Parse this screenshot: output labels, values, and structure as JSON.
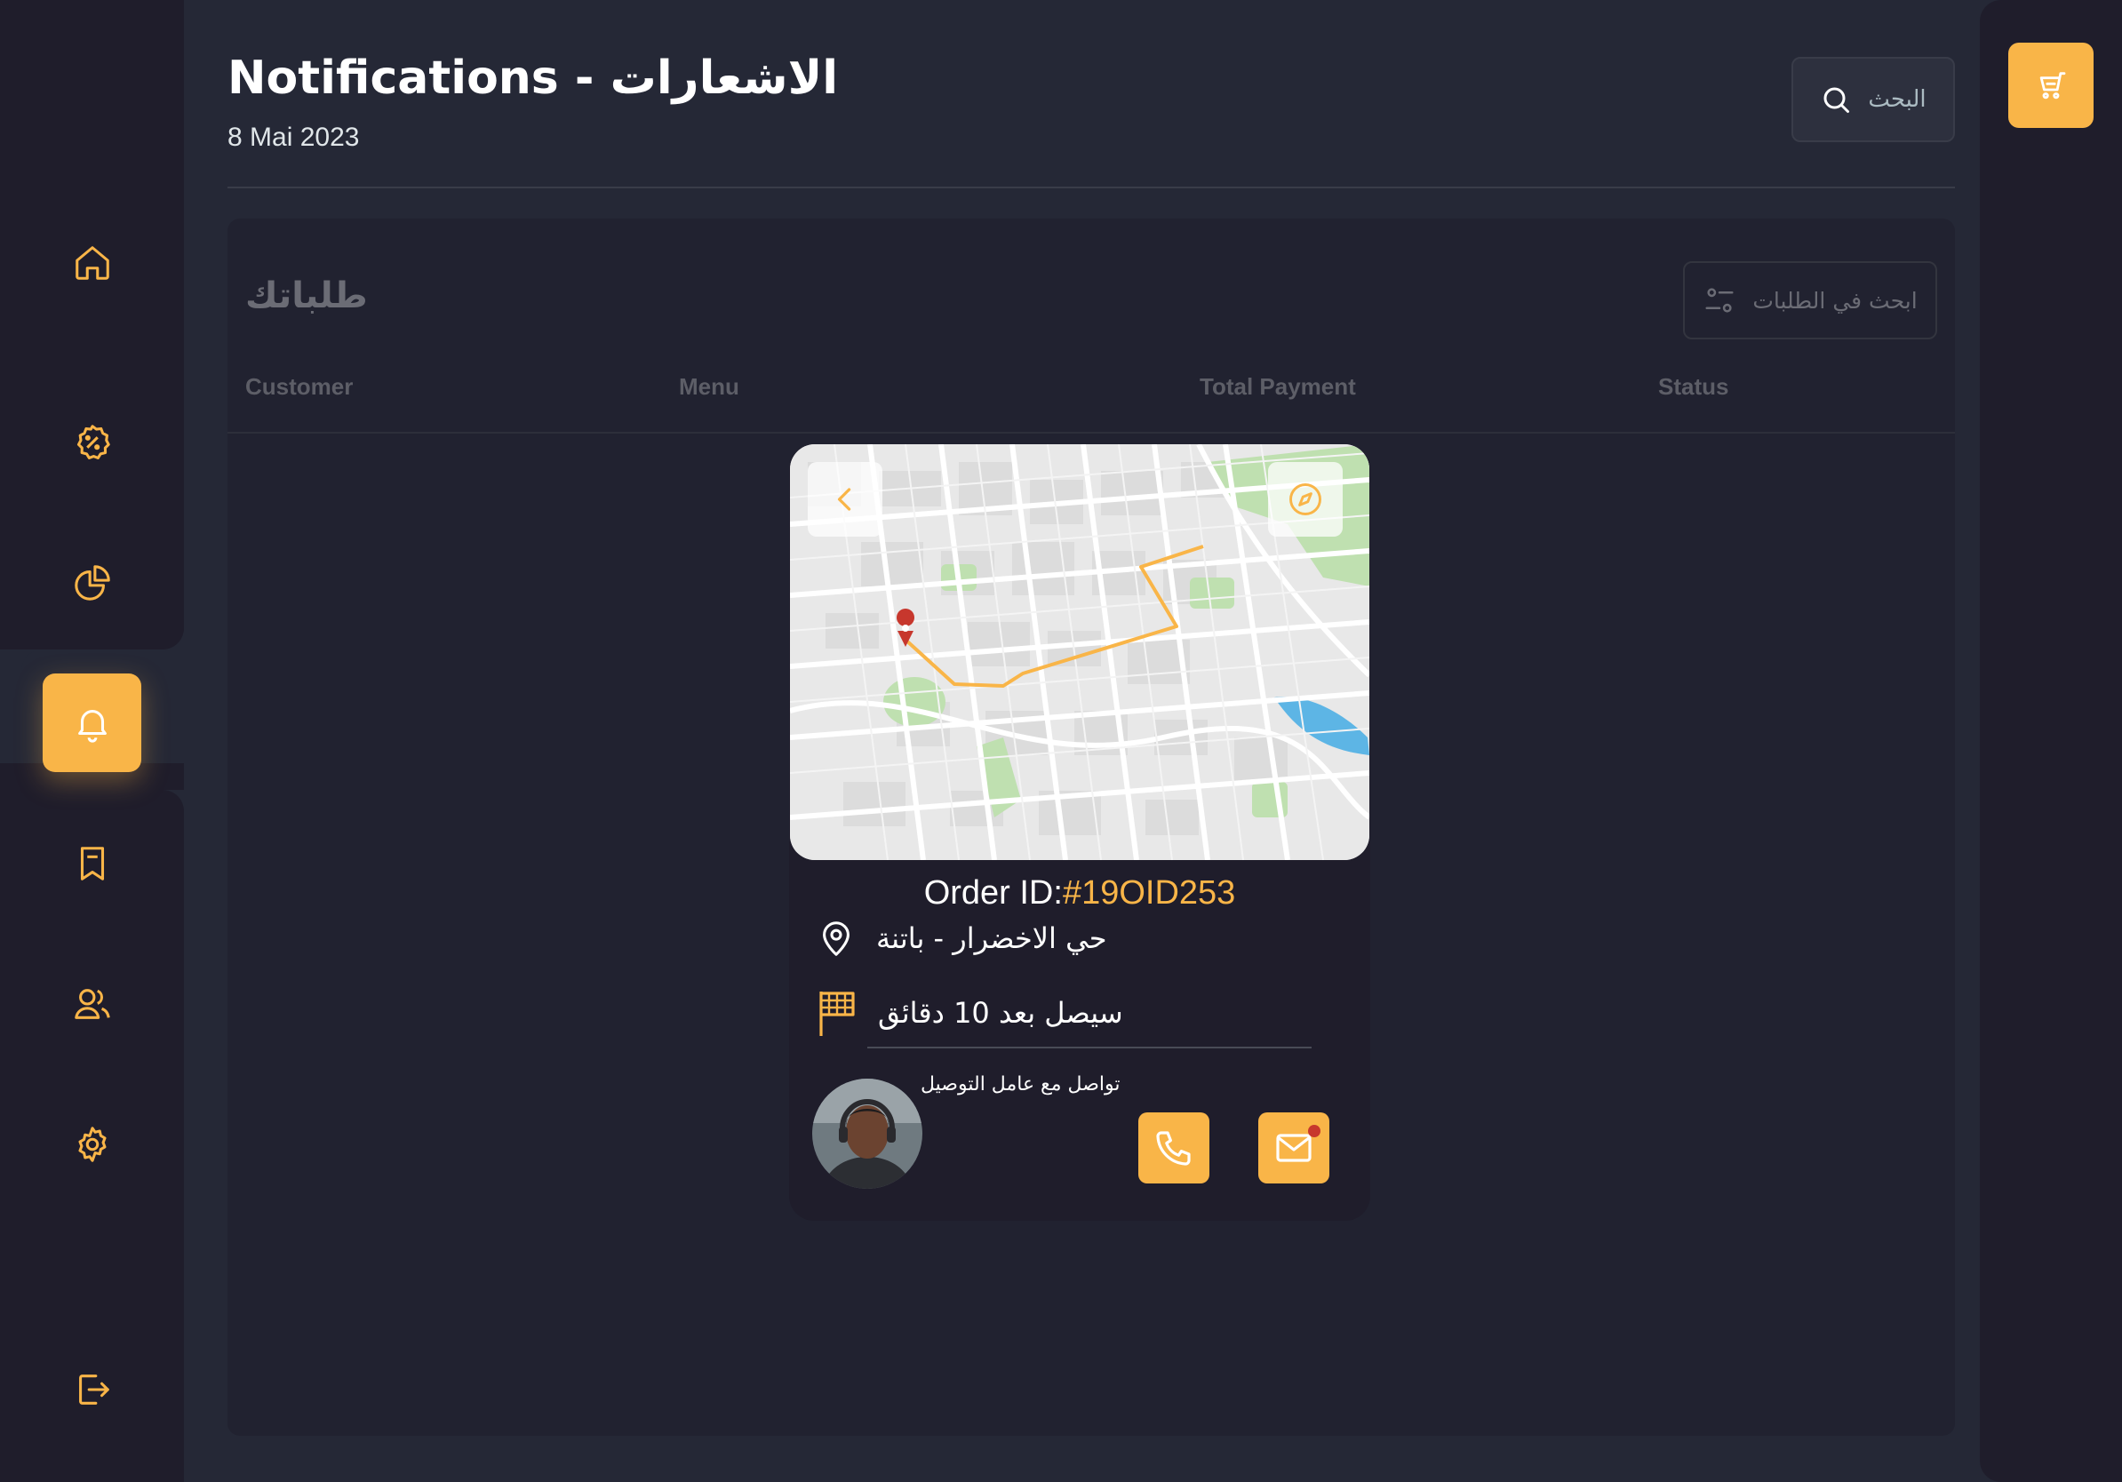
{
  "header": {
    "title": "Notifications - الاشعارات",
    "date": "8 Mai 2023",
    "search_placeholder": "البحث"
  },
  "sidebar": {
    "items": [
      {
        "icon": "home-icon",
        "active": false
      },
      {
        "icon": "discount-icon",
        "active": false
      },
      {
        "icon": "pie-chart-icon",
        "active": false
      },
      {
        "icon": "bell-icon",
        "active": true
      },
      {
        "icon": "bookmark-icon",
        "active": false
      },
      {
        "icon": "users-icon",
        "active": false
      },
      {
        "icon": "settings-icon",
        "active": false
      }
    ],
    "logout_icon": "logout-icon"
  },
  "right_rail": {
    "cart_icon": "cart-icon"
  },
  "orders": {
    "title": "طلباتك",
    "search_placeholder": "ابحث في الطلبات",
    "columns": [
      "Customer",
      "Menu",
      "Total Payment",
      "Status"
    ]
  },
  "order_card": {
    "order_id_label": "Order ID:",
    "order_id": "#19OID253",
    "location": "حي الاخضرار - باتنة",
    "eta": "سيصل بعد 10 دقائق",
    "contact_label": "تواصل مع عامل التوصيل"
  },
  "colors": {
    "accent": "#f9b548",
    "background": "#252836",
    "panel": "#1f1d2b",
    "badge": "#c7372d"
  }
}
